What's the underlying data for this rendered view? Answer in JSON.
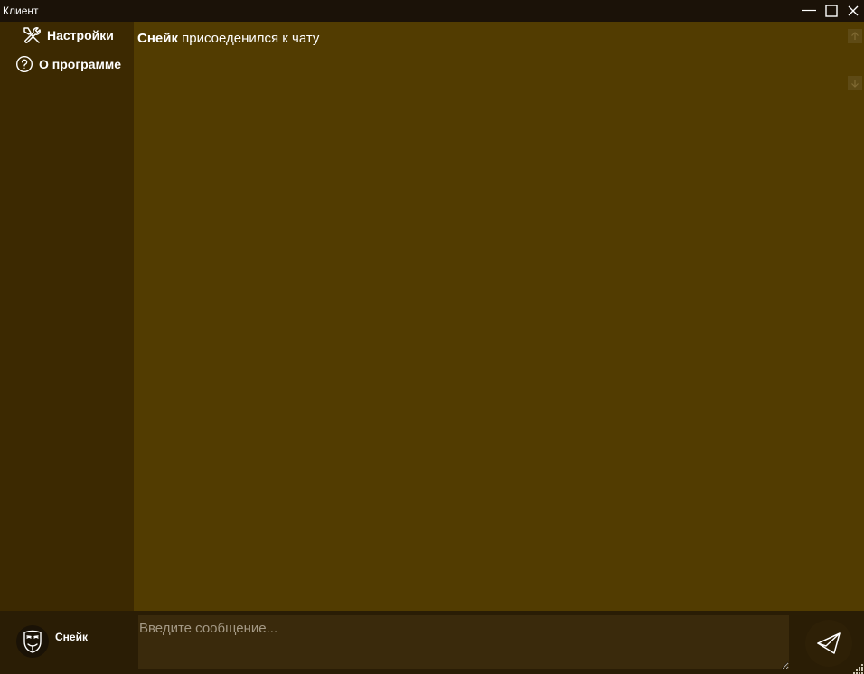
{
  "window": {
    "title": "Клиент"
  },
  "sidebar": {
    "items": [
      {
        "label": "Настройки",
        "icon": "tools-icon"
      },
      {
        "label": "О программе",
        "icon": "help-circle-icon"
      }
    ]
  },
  "chat": {
    "messages": [
      {
        "author": "Снейк",
        "text": "присоеденился к чату"
      }
    ]
  },
  "composer": {
    "username": "Снейк",
    "placeholder": "Введите сообщение...",
    "value": ""
  },
  "colors": {
    "titlebar": "#1b1208",
    "sidebar": "#3c2901",
    "chat_bg": "#523c01",
    "bottombar": "#2a1d05",
    "input_bg": "#3a2a0c"
  }
}
